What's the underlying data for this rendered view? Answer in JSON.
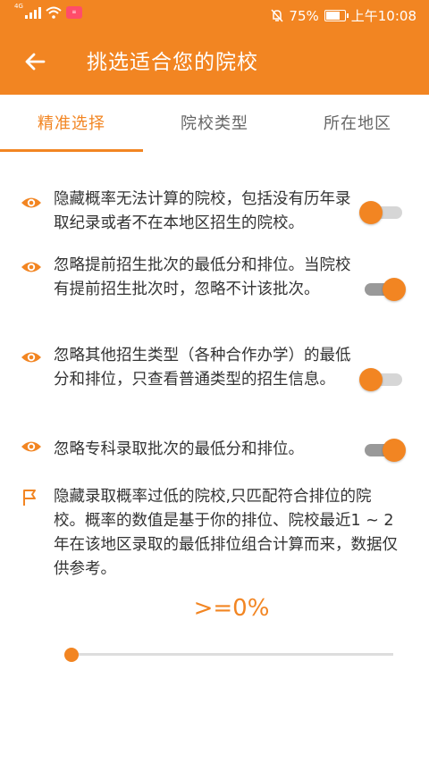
{
  "status_bar": {
    "network": "4G",
    "app_badge_icon": "app-notification-icon",
    "battery_percent": "75%",
    "time": "上午10:08"
  },
  "header": {
    "title": "挑选适合您的院校",
    "back_icon": "back-arrow-icon"
  },
  "tabs": [
    {
      "label": "精准选择",
      "active": true
    },
    {
      "label": "院校类型",
      "active": false
    },
    {
      "label": "所在地区",
      "active": false
    }
  ],
  "options": [
    {
      "icon": "eye-icon",
      "text": "隐藏概率无法计算的院校，包括没有历年录取纪录或者不在本地区招生的院校。",
      "toggle_on": false
    },
    {
      "icon": "eye-icon",
      "text": "忽略提前招生批次的最低分和排位。当院校有提前招生批次时，忽略不计该批次。",
      "toggle_on": true
    },
    {
      "icon": "eye-icon",
      "text": "忽略其他招生类型（各种合作办学）的最低分和排位，只查看普通类型的招生信息。",
      "toggle_on": false
    },
    {
      "icon": "eye-icon",
      "text": "忽略专科录取批次的最低分和排位。",
      "toggle_on": true
    }
  ],
  "probability": {
    "icon": "flag-icon",
    "description": "隐藏录取概率过低的院校,只匹配符合排位的院校。概率的数值是基于你的排位、院校最近1 ~ 2年在该地区录取的最低排位组合计算而来，数据仅供参考。",
    "value_label": ">=0%",
    "slider_value": 0
  },
  "colors": {
    "accent": "#f28522",
    "text": "#333333",
    "tab_inactive": "#666666"
  }
}
